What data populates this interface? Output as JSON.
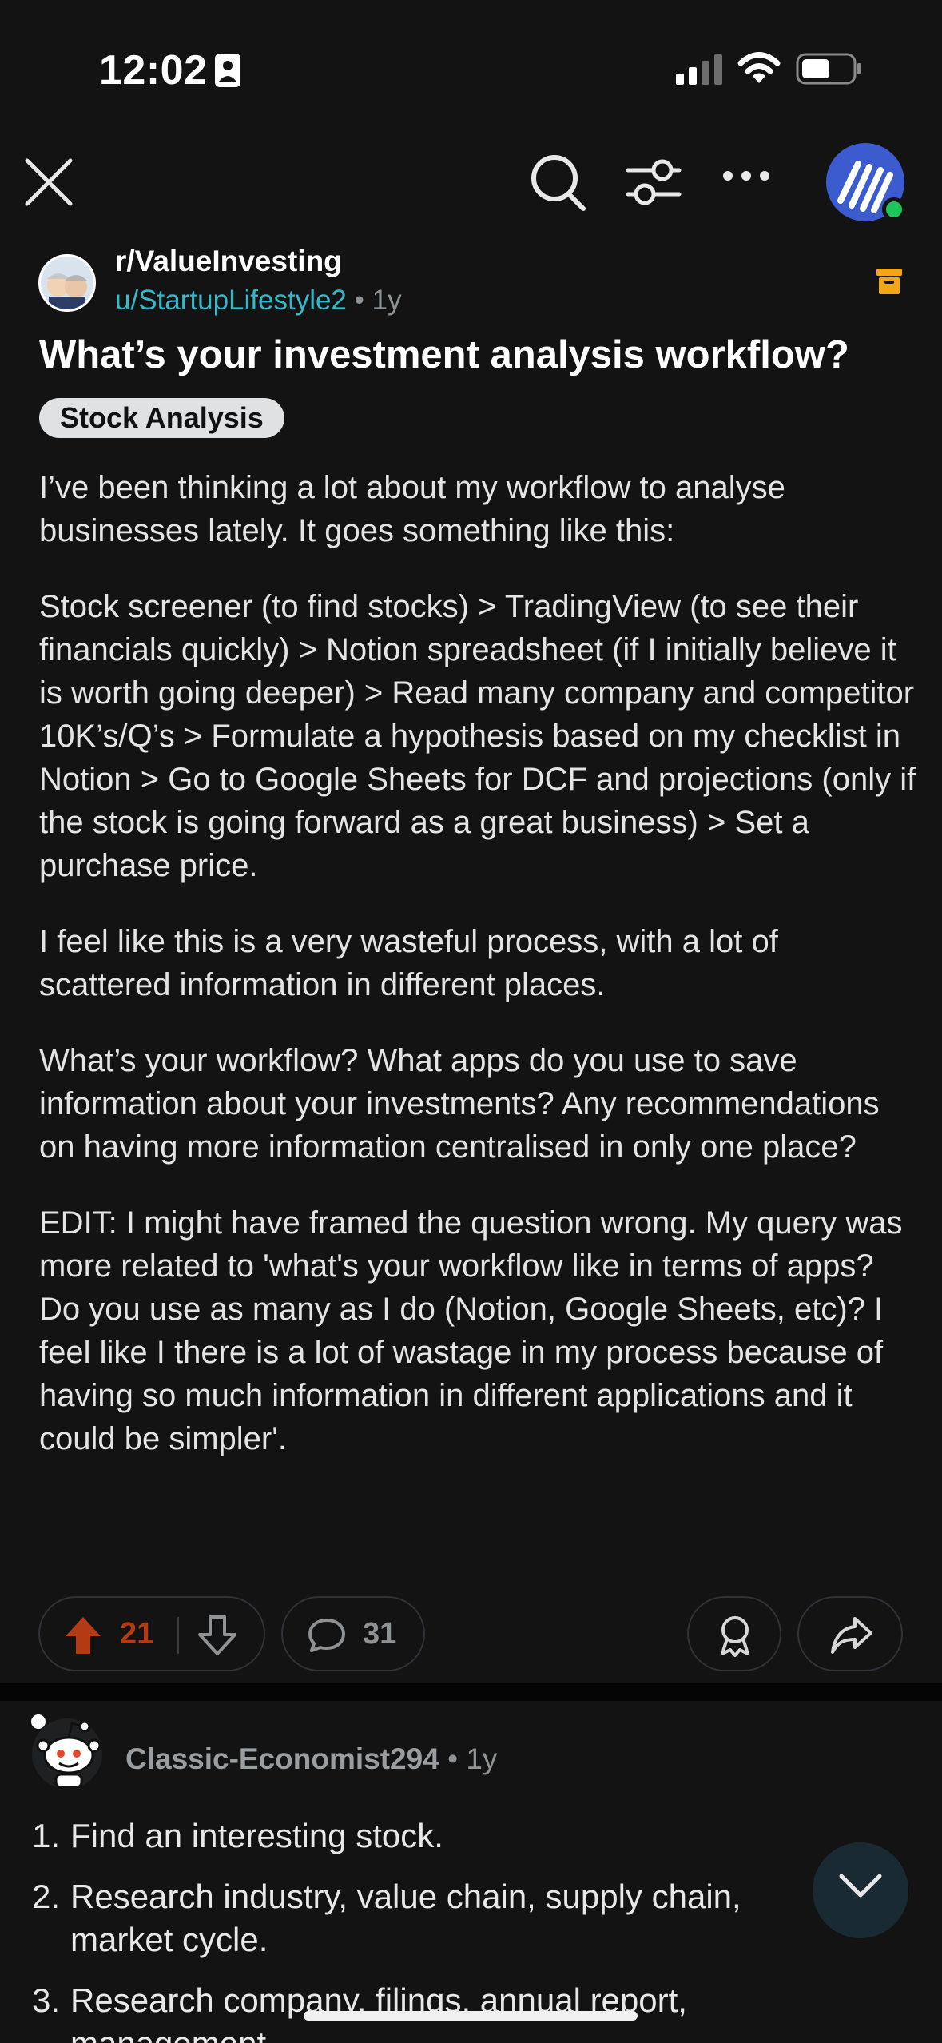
{
  "status_bar": {
    "time": "12:02"
  },
  "subreddit": {
    "name": "r/ValueInvesting"
  },
  "post": {
    "author": "u/StartupLifestyle2",
    "separator": "•",
    "age": "1y",
    "title": "What’s your investment analysis workflow?",
    "flair": "Stock Analysis",
    "paragraphs": [
      "I’ve been thinking a lot about my workflow to analyse businesses lately. It goes something like this:",
      "Stock screener (to find stocks) > TradingView (to see their financials quickly) > Notion spreadsheet (if I initially believe it is worth going deeper) > Read many company and competitor 10K’s/Q’s > Formulate a hypothesis based on my checklist in Notion > Go to Google Sheets for DCF and projections (only if the stock is going forward as a great business) > Set a purchase price.",
      "I feel like this is a very wasteful process, with a lot of scattered information in different places.",
      "What’s your workflow? What apps do you use to save information about your investments? Any recommendations on having more information centralised in only one place?",
      "EDIT: I might have framed the question wrong. My query was more related to 'what's your workflow like in terms of apps? Do you use as many as I do (Notion, Google Sheets, etc)? I feel like I there is a lot of wastage in my process because of having so much information in different applications and it could be simpler'."
    ],
    "votes": "21",
    "comments": "31"
  },
  "comment": {
    "author": "Classic-Economist294",
    "separator": "•",
    "age": "1y",
    "items": [
      {
        "num": "1.",
        "text": "Find an interesting stock."
      },
      {
        "num": "2.",
        "text": "Research industry, value chain, supply chain, market cycle."
      },
      {
        "num": "3.",
        "text": "Research company, filings, annual report, management"
      }
    ]
  },
  "colors": {
    "background": "#131313",
    "author_link": "#35b8c9",
    "upvote": "#b33a12",
    "archive": "#f2a516",
    "online": "#1fc35c"
  },
  "icons": [
    "close-icon",
    "search-icon",
    "filter-icon",
    "more-icon",
    "archive-icon",
    "upvote-icon",
    "downvote-icon",
    "comment-icon",
    "award-icon",
    "share-icon",
    "chevron-down-icon"
  ]
}
